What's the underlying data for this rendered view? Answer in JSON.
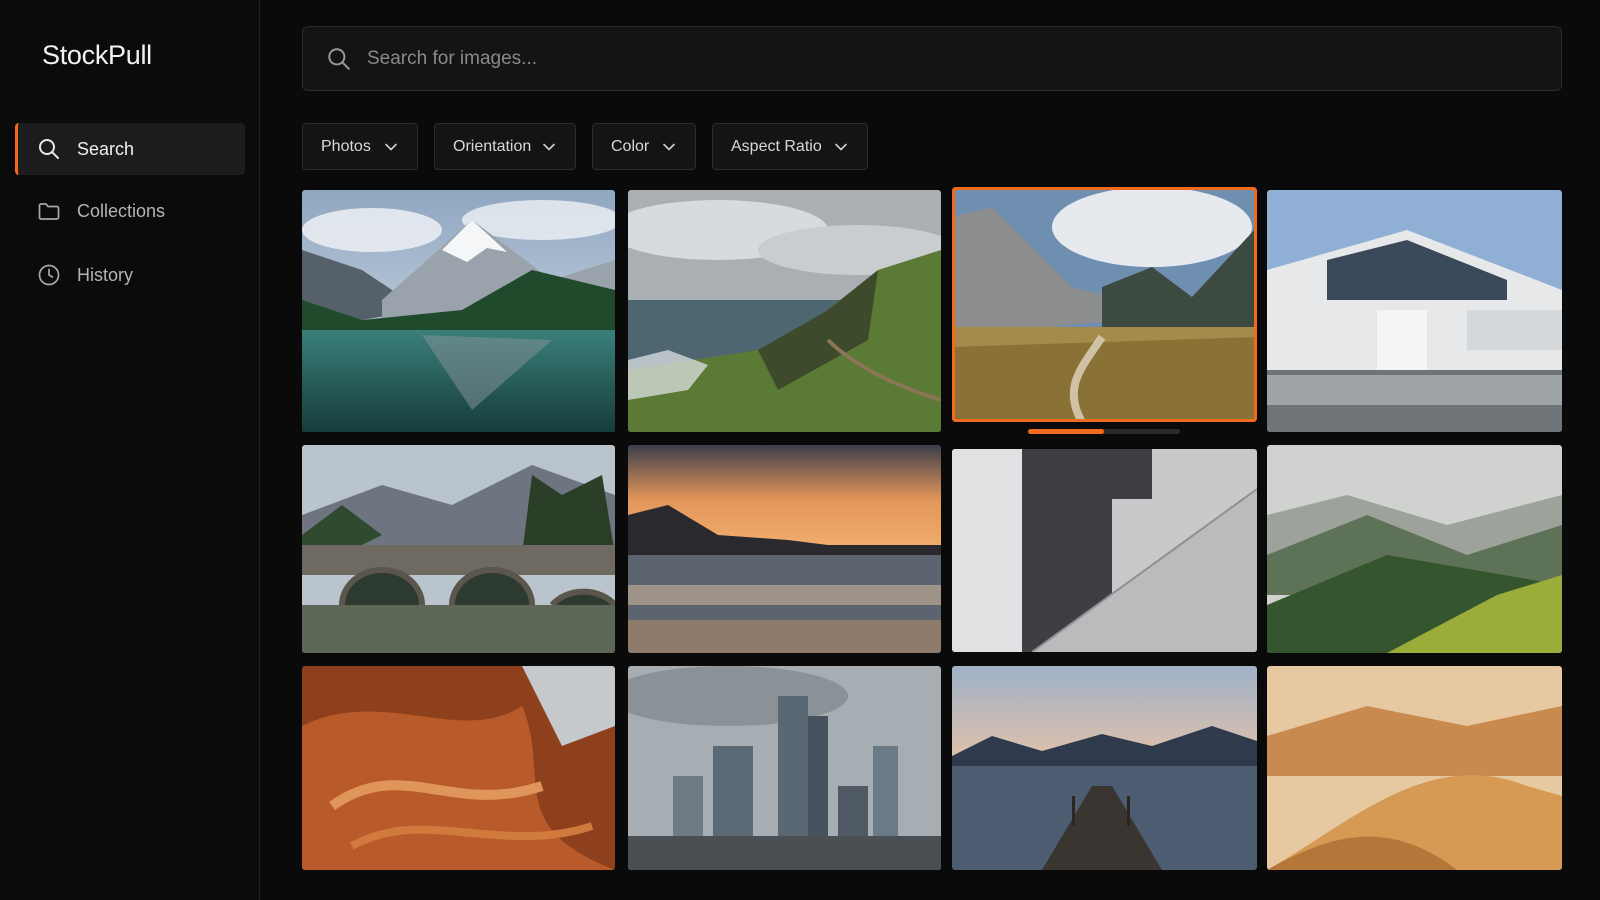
{
  "app": {
    "name": "StockPull"
  },
  "sidebar": {
    "items": [
      {
        "label": "Search",
        "icon": "search-icon",
        "active": true
      },
      {
        "label": "Collections",
        "icon": "folder-icon",
        "active": false
      },
      {
        "label": "History",
        "icon": "clock-icon",
        "active": false
      }
    ]
  },
  "search": {
    "placeholder": "Search for images...",
    "value": ""
  },
  "filters": [
    {
      "label": "Photos"
    },
    {
      "label": "Orientation"
    },
    {
      "label": "Color"
    },
    {
      "label": "Aspect Ratio"
    }
  ],
  "gallery": {
    "selected_index": 2,
    "selection_progress": 0.5,
    "images": [
      {
        "subject": "mountain lake reflection"
      },
      {
        "subject": "coastal cliff trail"
      },
      {
        "subject": "mountain valley path"
      },
      {
        "subject": "modern white building"
      },
      {
        "subject": "stone bridge mountains"
      },
      {
        "subject": "ocean sunset"
      },
      {
        "subject": "concrete architecture"
      },
      {
        "subject": "misty green hills"
      },
      {
        "subject": "red sandstone canyon"
      },
      {
        "subject": "city skyline"
      },
      {
        "subject": "lake pier at dusk"
      },
      {
        "subject": "desert dunes"
      }
    ]
  },
  "colors": {
    "accent": "#f26b1d",
    "background": "#0a0a0b",
    "surface": "#141416"
  }
}
